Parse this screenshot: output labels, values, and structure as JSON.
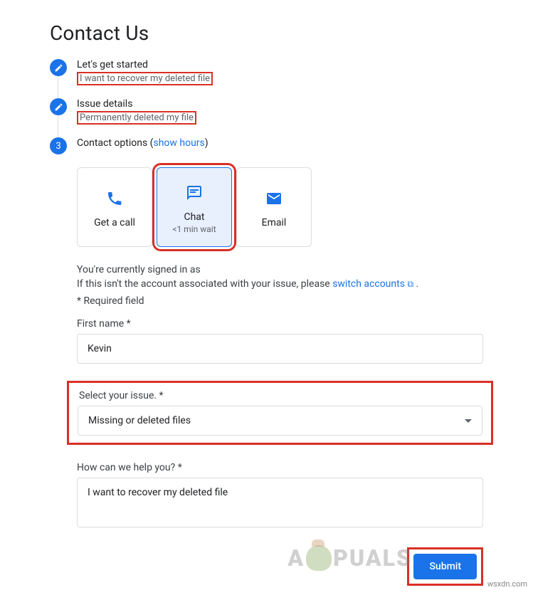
{
  "page_title": "Contact Us",
  "steps": [
    {
      "type": "edit",
      "title": "Let's get started",
      "sub": "I want to recover my deleted file"
    },
    {
      "type": "edit",
      "title": "Issue details",
      "sub": "Permanently deleted my file"
    },
    {
      "type": "number",
      "number": "3",
      "title": "Contact options",
      "link": "show hours"
    }
  ],
  "contact_options": [
    {
      "icon": "phone",
      "label": "Get a call",
      "sub": "",
      "selected": false
    },
    {
      "icon": "chat",
      "label": "Chat",
      "sub": "<1 min wait",
      "selected": true
    },
    {
      "icon": "email",
      "label": "Email",
      "sub": "",
      "selected": false
    }
  ],
  "form": {
    "signed_in_prefix": "You're currently signed in as",
    "not_account_text": "If this isn't the account associated with your issue, please ",
    "switch_accounts": "switch accounts",
    "required_text": "* Required field",
    "first_name_label": "First name *",
    "first_name_value": "Kevin",
    "issue_label": "Select your issue. *",
    "issue_value": "Missing or deleted files",
    "help_label": "How can we help you? *",
    "help_value": "I want to recover my deleted file",
    "submit_label": "Submit"
  },
  "watermark": {
    "left": "A",
    "right": "PUALS"
  },
  "credit": "wsxdn.com"
}
